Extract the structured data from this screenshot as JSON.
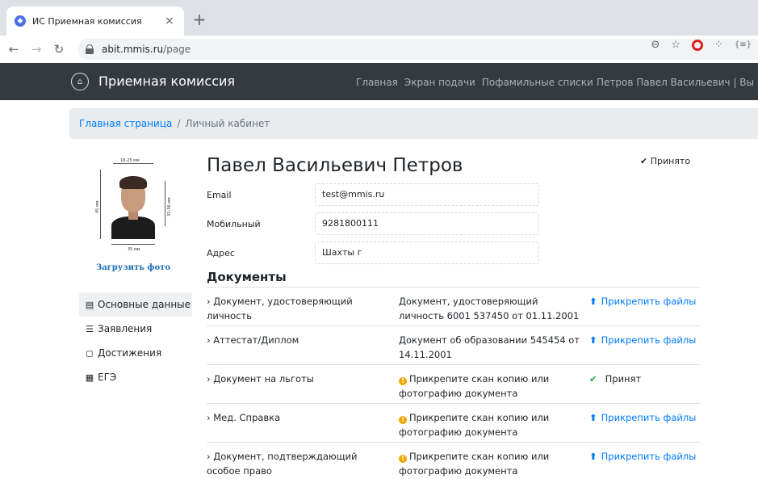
{
  "browser": {
    "tab_title": "ИС Приемная комиссия",
    "tab_close": "×",
    "new_tab": "+",
    "url_host": "abit.mmis.ru",
    "url_path": "/page"
  },
  "navbar": {
    "brand": "Приемная комиссия",
    "links": [
      "Главная",
      "Экран подачи",
      "Пофамильные списки"
    ],
    "user": "Петров Павел Васильевич |  Вы"
  },
  "breadcrumb": {
    "home": "Главная страница",
    "separator": "/",
    "current": "Личный кабинет"
  },
  "photo": {
    "dim_top": "18-25 мм",
    "dim_left": "45 мм",
    "dim_right": "32-36 мм",
    "dim_bottom": "35 мм",
    "upload_label": "Загрузить фото"
  },
  "sidebar": {
    "items": [
      {
        "icon": "id-card-icon",
        "label": "Основные данные",
        "active": true
      },
      {
        "icon": "list-icon",
        "label": "Заявления"
      },
      {
        "icon": "bookmark-icon",
        "label": "Достижения"
      },
      {
        "icon": "keyboard-icon",
        "label": "ЕГЭ"
      }
    ]
  },
  "profile": {
    "name": "Павел Васильевич Петров",
    "status": "✔ Принято",
    "fields": [
      {
        "label": "Email",
        "value": "test@mmis.ru"
      },
      {
        "label": "Мобильный",
        "value": "9281800111"
      },
      {
        "label": "Адрес",
        "value": "Шахты г"
      }
    ]
  },
  "documents": {
    "title": "Документы",
    "rows": [
      {
        "name": "›  Документ, удостоверяющий личность",
        "info": "Документ, удостоверяющий личность 6001 537450 от 01.11.2001",
        "warn": false,
        "action": "Прикрепить файлы",
        "action_type": "upload"
      },
      {
        "name": "›  Аттестат/Диплом",
        "info": "Документ об образовании 545454 от 14.11.2001",
        "warn": false,
        "action": "Прикрепить файлы",
        "action_type": "upload"
      },
      {
        "name": "›  Документ на льготы",
        "info": "Прикрепите скан копию или фотографию документа",
        "warn": true,
        "action": "Принят",
        "action_type": "accepted"
      },
      {
        "name": "›  Мед. Справка",
        "info": "Прикрепите скан копию или фотографию документа",
        "warn": true,
        "action": "Прикрепить файлы",
        "action_type": "upload"
      },
      {
        "name": "›  Документ, подтверждающий особое право",
        "info": "Прикрепите скан копию или фотографию документа",
        "warn": true,
        "action": "Прикрепить файлы",
        "action_type": "upload"
      }
    ]
  },
  "colors": {
    "navbar_bg": "#343a40",
    "link": "#007bff",
    "warning": "#f0a500",
    "success": "#28a745"
  }
}
